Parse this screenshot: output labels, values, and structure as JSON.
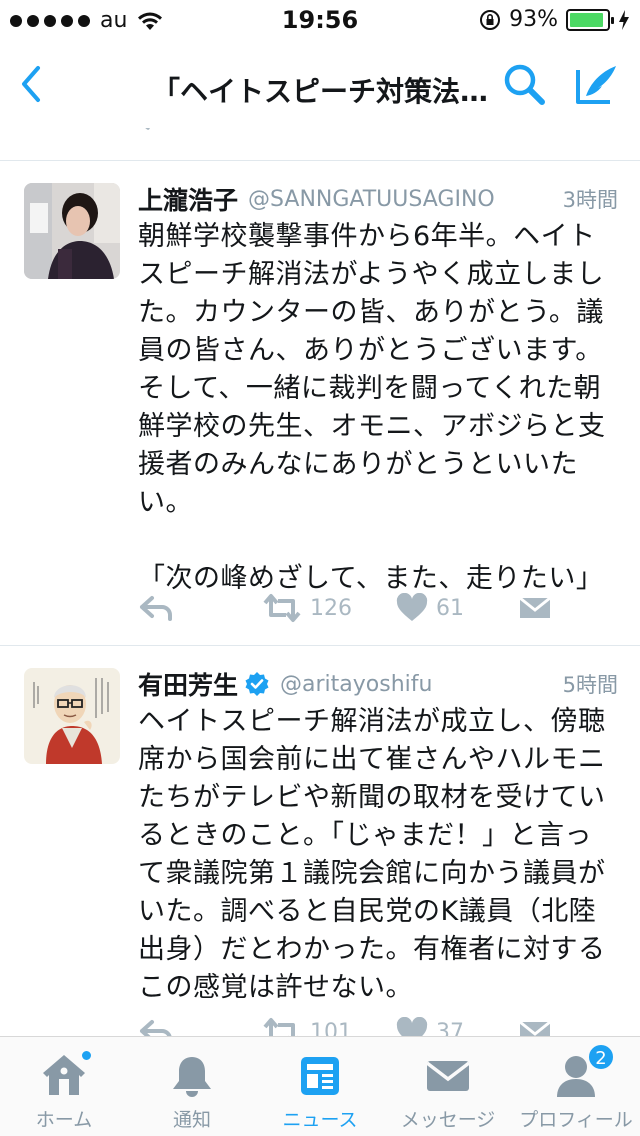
{
  "status_bar": {
    "carrier": "au",
    "time": "19:56",
    "battery_percent": "93%",
    "battery_level": 0.93,
    "battery_color": "#4cd964"
  },
  "nav": {
    "title": "「ヘイトスピーチ対策法…",
    "accent_color": "#1da1f2"
  },
  "tweets": [
    {
      "display_name": "上瀧浩子",
      "handle": "@SANNGATUUSAGINO",
      "time": "3時間",
      "text": "朝鮮学校襲撃事件から6年半。ヘイトスピーチ解消法がようやく成立しました。カウンターの皆、ありがとう。議員の皆さん、ありがとうございます。そして、一緒に裁判を闘ってくれた朝鮮学校の先生、オモニ、アボジらと支援者のみんなにありがとうといいたい。\n\n「次の峰めざして、また、走りたい」",
      "retweets": "126",
      "likes": "61",
      "verified": false
    },
    {
      "display_name": "有田芳生",
      "handle": "@aritayoshifu",
      "time": "5時間",
      "text": "ヘイトスピーチ解消法が成立し、傍聴席から国会前に出て崔さんやハルモニたちがテレビや新聞の取材を受けているときのこと。「じゃまだ！」と言って衆議院第１議院会館に向かう議員がいた。調べると自民党のK議員（北陸出身）だとわかった。有権者に対するこの感覚は許せない。",
      "retweets": "101",
      "likes": "37",
      "verified": true
    }
  ],
  "tabs": [
    {
      "label": "ホーム",
      "icon": "home-icon",
      "active": false
    },
    {
      "label": "通知",
      "icon": "bell-icon",
      "active": false
    },
    {
      "label": "ニュース",
      "icon": "news-icon",
      "active": true
    },
    {
      "label": "メッセージ",
      "icon": "envelope-icon",
      "active": false
    },
    {
      "label": "プロフィール",
      "icon": "profile-icon",
      "active": false,
      "badge": "2"
    }
  ]
}
